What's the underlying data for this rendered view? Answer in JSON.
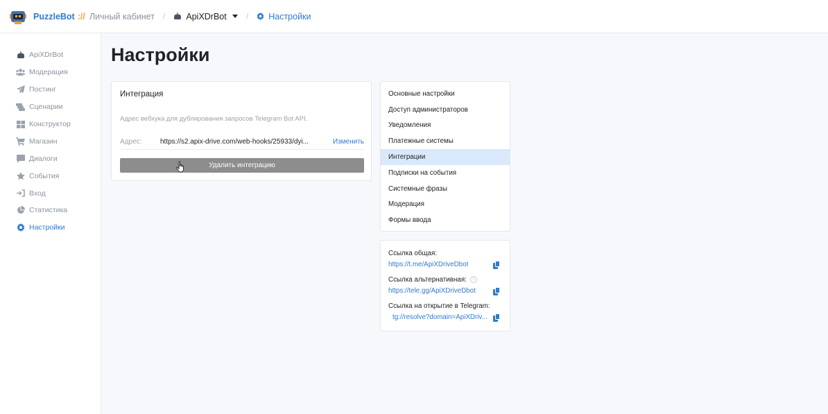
{
  "header": {
    "brand": "PuzzleBot",
    "brand_sep": "://",
    "crumb_cabinet": "Личный кабинет",
    "crumb_sep": "/",
    "bot_name": "ApiXDrBot",
    "crumb_current": "Настройки"
  },
  "sidebar": {
    "items": [
      {
        "label": "ApiXDrBot",
        "icon": "bot-icon"
      },
      {
        "label": "Модерация",
        "icon": "users-icon"
      },
      {
        "label": "Постинг",
        "icon": "send-icon"
      },
      {
        "label": "Сценарии",
        "icon": "scenarios-icon"
      },
      {
        "label": "Конструктор",
        "icon": "grid-icon"
      },
      {
        "label": "Магазин",
        "icon": "cart-icon"
      },
      {
        "label": "Диалоги",
        "icon": "chat-icon"
      },
      {
        "label": "События",
        "icon": "star-icon"
      },
      {
        "label": "Вход",
        "icon": "login-icon"
      },
      {
        "label": "Статистика",
        "icon": "pie-chart-icon"
      },
      {
        "label": "Настройки",
        "icon": "gear-icon"
      }
    ]
  },
  "page": {
    "title": "Настройки"
  },
  "integration": {
    "title": "Интеграция",
    "description": "Адрес вебхука для дублирования запросов Telegram Bot API.",
    "address_label": "Адрес:",
    "address_value": "https://s2.apix-drive.com/web-hooks/25933/dyi...",
    "change_label": "Изменить",
    "delete_label": "Удалить интеграцию"
  },
  "settings_menu": {
    "items": [
      "Основные настройки",
      "Доступ администраторов",
      "Уведомления",
      "Платежные системы",
      "Интеграции",
      "Подписки на события",
      "Системные фразы",
      "Модерация",
      "Формы ввода"
    ],
    "active": "Интеграции"
  },
  "links": {
    "general_label": "Ссылка общая:",
    "general_url": "https://t.me/ApiXDriveDbot",
    "alt_label": "Ссылка альтернативная:",
    "alt_help": "?",
    "alt_url": "https://tele.gg/ApiXDriveDbot",
    "open_label": "Ссылка на открытие в Telegram:",
    "open_url": "tg://resolve?domain=ApiXDriv..."
  },
  "colors": {
    "accent": "#2f7bd1",
    "active_menu_bg": "#d9e8fb",
    "delete_button": "#8d8d8d"
  }
}
